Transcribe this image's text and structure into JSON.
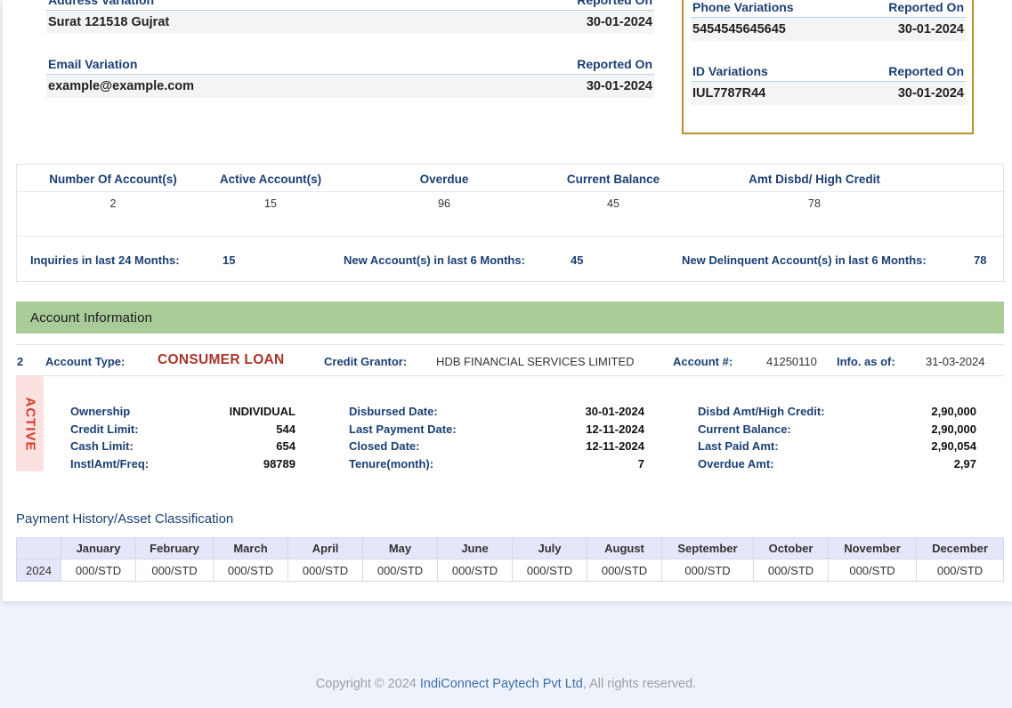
{
  "address_variation": {
    "header": "Address Variation",
    "reported_on_label": "Reported On",
    "value": "Surat 121518 Gujrat",
    "date": "30-01-2024"
  },
  "email_variation": {
    "header": "Email Variation",
    "reported_on_label": "Reported On",
    "value": "example@example.com",
    "date": "30-01-2024"
  },
  "phone_variations": {
    "header": "Phone Variations",
    "reported_on_label": "Reported On",
    "value": "5454545645645",
    "date": "30-01-2024"
  },
  "id_variations": {
    "header": "ID Variations",
    "reported_on_label": "Reported On",
    "value": "IUL7787R44",
    "date": "30-01-2024"
  },
  "summary": {
    "columns": [
      {
        "label": "Number Of Account(s)",
        "value": "2"
      },
      {
        "label": "Active Account(s)",
        "value": "15"
      },
      {
        "label": "Overdue",
        "value": "96"
      },
      {
        "label": "Current Balance",
        "value": "45"
      },
      {
        "label": "Amt Disbd/ High Credit",
        "value": "78"
      }
    ],
    "inquiries_label": "Inquiries in last 24 Months:",
    "inquiries_value": "15",
    "new_accounts_label": "New Account(s) in last 6 Months:",
    "new_accounts_value": "45",
    "new_delinquent_label": "New Delinquent Account(s) in last 6 Months:",
    "new_delinquent_value": "78"
  },
  "account_info": {
    "title": "Account Information",
    "index": "2",
    "account_type_label": "Account Type:",
    "account_type": "CONSUMER LOAN",
    "credit_grantor_label": "Credit Grantor:",
    "credit_grantor": "HDB FINANCIAL SERVICES LIMITED",
    "account_no_label": "Account #:",
    "account_no": "41250110",
    "info_as_of_label": "Info. as of:",
    "info_as_of": "31-03-2024",
    "status": "ACTIVE",
    "col1": [
      {
        "label": "Ownership",
        "value": "INDIVIDUAL"
      },
      {
        "label": "Credit Limit:",
        "value": "544"
      },
      {
        "label": "Cash Limit:",
        "value": "654"
      },
      {
        "label": "InstlAmt/Freq:",
        "value": "98789"
      }
    ],
    "col2": [
      {
        "label": "Disbursed Date:",
        "value": "30-01-2024"
      },
      {
        "label": "Last Payment Date:",
        "value": "12-11-2024"
      },
      {
        "label": "Closed Date:",
        "value": "12-11-2024"
      },
      {
        "label": "Tenure(month):",
        "value": "7"
      }
    ],
    "col3": [
      {
        "label": "Disbd Amt/High Credit:",
        "value": "2,90,000"
      },
      {
        "label": "Current Balance:",
        "value": "2,90,000"
      },
      {
        "label": "Last Paid Amt:",
        "value": "2,90,054"
      },
      {
        "label": "Overdue Amt:",
        "value": "2,97"
      }
    ]
  },
  "payment_history": {
    "title": "Payment History/Asset Classification",
    "months": [
      "January",
      "February",
      "March",
      "April",
      "May",
      "June",
      "July",
      "August",
      "September",
      "October",
      "November",
      "December"
    ],
    "rows": [
      {
        "year": "2024",
        "values": [
          "000/STD",
          "000/STD",
          "000/STD",
          "000/STD",
          "000/STD",
          "000/STD",
          "000/STD",
          "000/STD",
          "000/STD",
          "000/STD",
          "000/STD",
          "000/STD"
        ]
      }
    ]
  },
  "footer": {
    "prefix": "Copyright © 2024 ",
    "brand": "IndiConnect Paytech Pvt Ltd",
    "suffix": ", All rights reserved."
  }
}
